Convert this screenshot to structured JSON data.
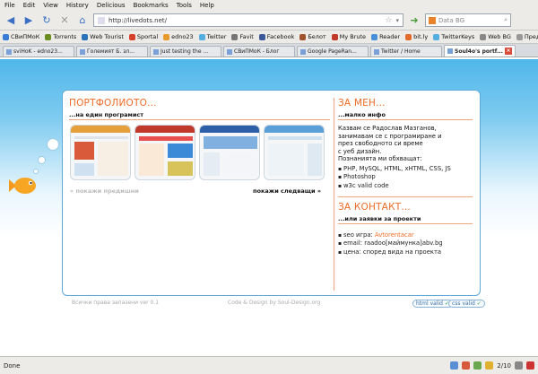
{
  "menu": [
    "File",
    "Edit",
    "View",
    "History",
    "Delicious",
    "Bookmarks",
    "Tools",
    "Help"
  ],
  "url": "http://livedots.net/",
  "search_placeholder": "Data BG",
  "bookmarks": [
    {
      "label": "СВиПМоК",
      "color": "#3a7bd5"
    },
    {
      "label": "Torrents",
      "color": "#6b8e23"
    },
    {
      "label": "Web Tourist",
      "color": "#2a73b8"
    },
    {
      "label": "Sportal",
      "color": "#d6402a"
    },
    {
      "label": "edno23",
      "color": "#e89a2a"
    },
    {
      "label": "Twitter",
      "color": "#55aee0"
    },
    {
      "label": "Favit",
      "color": "#777"
    },
    {
      "label": "Facebook",
      "color": "#3b5998"
    },
    {
      "label": "Белот",
      "color": "#a0522d"
    },
    {
      "label": "My Brute",
      "color": "#c0392b"
    },
    {
      "label": "Reader",
      "color": "#4a90d9"
    },
    {
      "label": "bit.ly",
      "color": "#e26b2b"
    },
    {
      "label": "TwitterKeys",
      "color": "#55aee0"
    },
    {
      "label": "Web BG",
      "color": "#888"
    },
    {
      "label": "Пред.",
      "color": "#999"
    }
  ],
  "tabs": [
    "sviHoK - edno23...",
    "Големият Б. зл...",
    "Just testing the ...",
    "СВиПМоК - Блог",
    "Google PageRan...",
    "Twitter / Home",
    "Soul4o's portf..."
  ],
  "page": {
    "portfolio_title": "ПОРТФОЛИОТО...",
    "portfolio_sub": "...на един програмист",
    "prev": "« покажи предишни",
    "next": "покажи следващи »",
    "about_title": "ЗА МЕН...",
    "about_sub": "...малко инфо",
    "about_text": [
      "Казвам се Радослав Мазганов,",
      "занимавам се с програмиране и",
      "през свободното си време",
      "с уеб дизайн.",
      "Познанията ми обхващат:"
    ],
    "skills": [
      "PHP, MySQL, HTML, xHTML, CSS, JS",
      "Photoshop",
      "w3c valid code"
    ],
    "contact_title": "ЗА КОНТАКТ...",
    "contact_sub": "...или заявки за проекти",
    "contact_items": [
      {
        "label": "seo игра: ",
        "value": "Avtorentacar"
      },
      {
        "label": "email: ",
        "value": "raadoo[маймунка]abv.bg"
      },
      {
        "label": "цена: ",
        "value": "според вида на проекта"
      }
    ],
    "footer_left": "Всички права запазени ver 0.1",
    "footer_center": "Code & Design by Soul-Design.org",
    "badge_html": "html valid",
    "badge_css": "css valid"
  },
  "status": {
    "text": "Done",
    "counter": "2/10"
  },
  "colors": {
    "accent": "#ef6a25",
    "sky": "#4fb7ea",
    "link": "#ef6a25"
  }
}
